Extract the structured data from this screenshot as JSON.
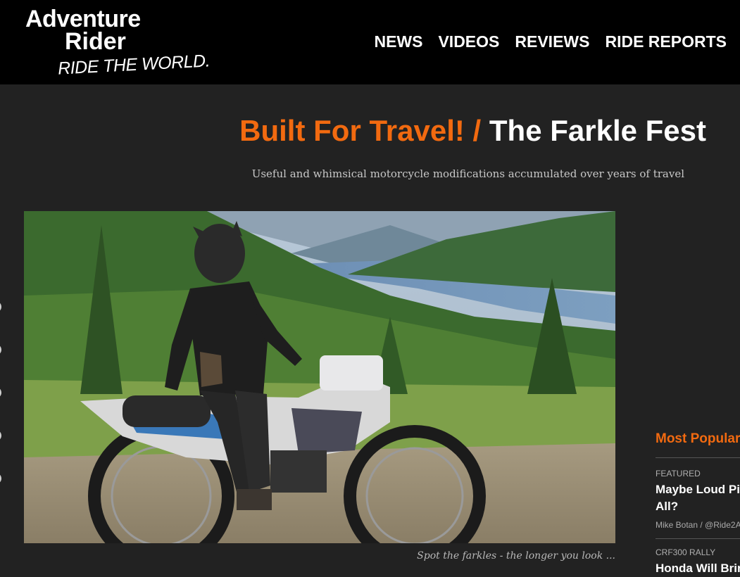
{
  "logo": {
    "line1": "Adventure",
    "line2": "Rider",
    "tagline": "RIDE THE WORLD."
  },
  "nav": [
    {
      "label": "NEWS"
    },
    {
      "label": "VIDEOS"
    },
    {
      "label": "REVIEWS"
    },
    {
      "label": "RIDE REPORTS"
    }
  ],
  "article": {
    "category": "Built For Travel!",
    "separator": "/",
    "title": "The Farkle Fest",
    "subtitle": "Useful and whimsical motorcycle modifications accumulated over years of travel",
    "caption": "Spot the farkles - the longer you look ..."
  },
  "sidebar": {
    "heading": "Most Popular",
    "posts": [
      {
        "tag": "FEATURED",
        "title": "Maybe Loud Pi All?",
        "author": "Mike Botan / @Ride2A"
      },
      {
        "tag": "CRF300 RALLY",
        "title": "Honda Will Brin",
        "author": ""
      }
    ]
  },
  "colors": {
    "accent": "#f26a10",
    "header_bg": "#000000",
    "page_bg": "#222222"
  }
}
